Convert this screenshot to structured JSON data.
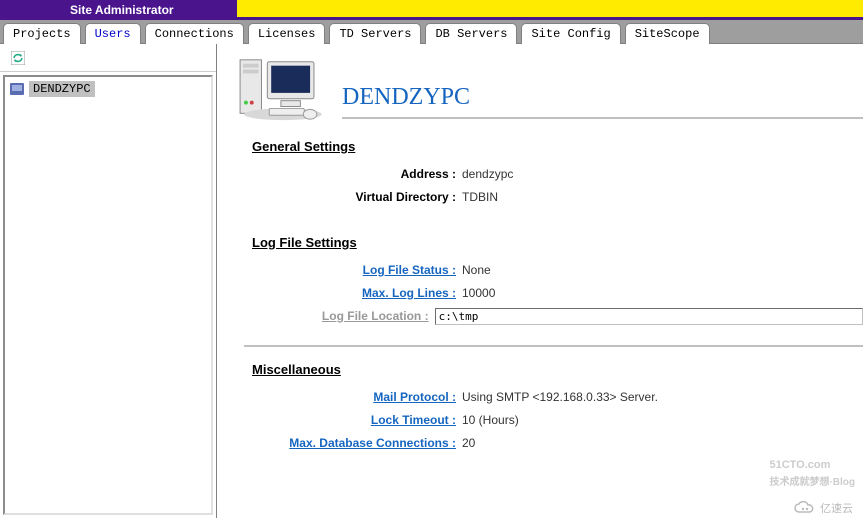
{
  "app": {
    "title": "Site Administrator"
  },
  "tabs": {
    "projects": "Projects",
    "users": "Users",
    "connections": "Connections",
    "licenses": "Licenses",
    "tdservers": "TD Servers",
    "dbservers": "DB Servers",
    "siteconfig": "Site Config",
    "sitescope": "SiteScope"
  },
  "tree": {
    "selected": "DENDZYPC"
  },
  "server": {
    "name": "DENDZYPC",
    "general": {
      "heading": "General Settings",
      "address_label": "Address :",
      "address_value": "dendzypc",
      "vdir_label": "Virtual Directory :",
      "vdir_value": "TDBIN"
    },
    "logfile": {
      "heading": "Log File Settings",
      "status_label": "Log File Status :",
      "status_value": "None",
      "maxlines_label": "Max. Log Lines :",
      "maxlines_value": "10000",
      "location_label": "Log File Location :",
      "location_value": "c:\\tmp"
    },
    "misc": {
      "heading": "Miscellaneous",
      "mail_label": "Mail Protocol :",
      "mail_value": "Using SMTP <192.168.0.33> Server.",
      "lock_label": "Lock Timeout :",
      "lock_value": "10 (Hours)",
      "maxdb_label": "Max. Database Connections :",
      "maxdb_value": "20"
    }
  },
  "watermark": {
    "main": "51CTO.com",
    "sub": "技术成就梦想·Blog",
    "w2": "亿速云"
  }
}
